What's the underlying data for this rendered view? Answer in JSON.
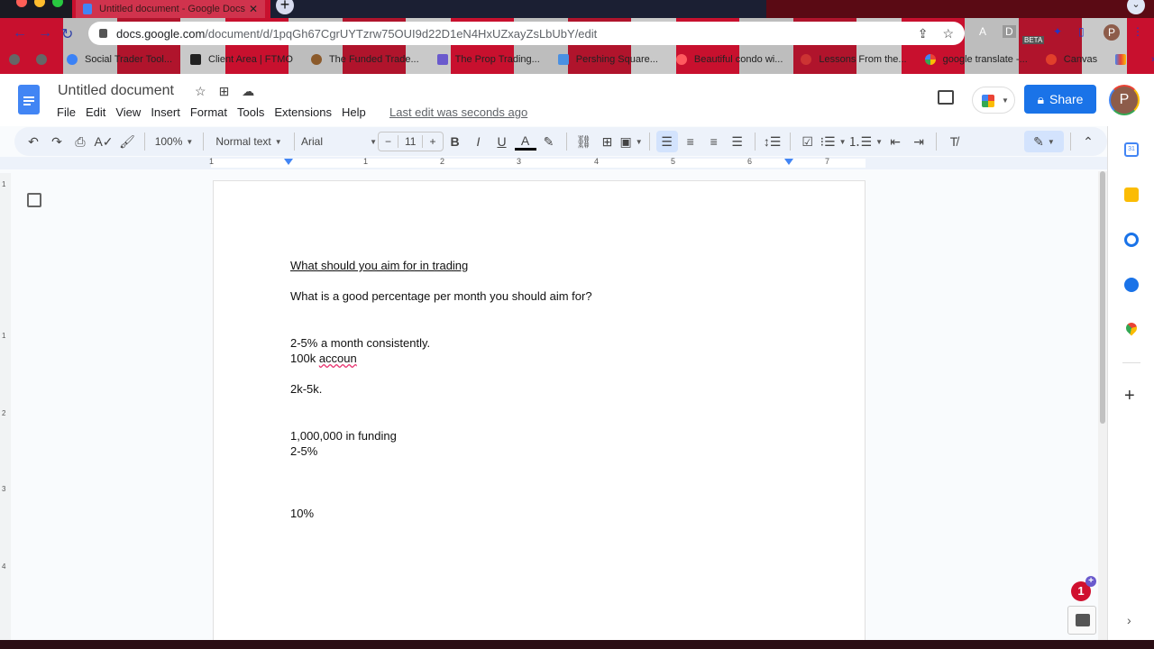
{
  "browser": {
    "tab_title": "Untitled document - Google Docs",
    "new_tab": "+",
    "tab_close": "✕",
    "url_host": "docs.google.com",
    "url_path": "/document/d/1pqGh67CgrUYTzrw75OUI9d22D1eN4HxUZxayZsLbUbY/edit",
    "extensions": [
      "A",
      "D",
      "BETA",
      "P"
    ],
    "profile_initial": "P",
    "bookmarks": [
      {
        "label": "Social Trader Tool...",
        "color": "#3b82f6"
      },
      {
        "label": "Client Area | FTMO",
        "color": "#222222"
      },
      {
        "label": "The Funded Trade...",
        "color": "#8b5a2b"
      },
      {
        "label": "The Prop Trading...",
        "color": "#6a5acd"
      },
      {
        "label": "Pershing Square...",
        "color": "#4a90e2"
      },
      {
        "label": "Beautiful condo wi...",
        "color": "#ff5a5f"
      },
      {
        "label": "Lessons From the...",
        "color": "#cc3333"
      },
      {
        "label": "google translate -...",
        "color": "#4285f4"
      },
      {
        "label": "Canvas",
        "color": "#e13f2b"
      }
    ],
    "more_bookmarks": "»"
  },
  "docs": {
    "title": "Untitled document",
    "menu": [
      "File",
      "Edit",
      "View",
      "Insert",
      "Format",
      "Tools",
      "Extensions",
      "Help"
    ],
    "last_edit": "Last edit was seconds ago",
    "share_label": "Share",
    "avatar_initial": "P",
    "toolbar": {
      "zoom": "100%",
      "style": "Normal text",
      "font": "Arial",
      "font_size": "11",
      "minus": "−",
      "plus": "+"
    },
    "ruler_numbers": [
      "1",
      "1",
      "2",
      "3",
      "4",
      "5",
      "6",
      "7"
    ],
    "vruler_numbers": [
      "1",
      "1",
      "2",
      "3",
      "4"
    ]
  },
  "document": {
    "heading": "What should you aim for in trading",
    "lines": [
      "What is a good percentage per month you should aim for?",
      "2-5% a month consistently.",
      "100k ",
      "accoun",
      "2k-5k.",
      "1,000,000 in funding",
      "2-5%",
      "10%"
    ]
  },
  "side_panel": {
    "calendar_day": "31",
    "add": "+",
    "notification_count": "1",
    "expand": "›"
  }
}
